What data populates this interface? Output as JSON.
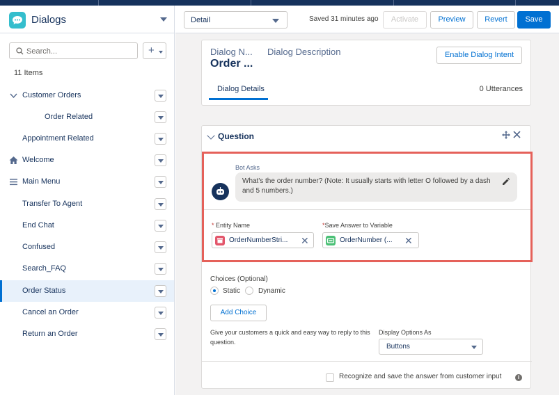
{
  "app": {
    "title": "Dialogs"
  },
  "sidebar": {
    "search_placeholder": "Search...",
    "new_button": "+",
    "items_count": "11 Items",
    "items": [
      {
        "label": "Customer Orders"
      },
      {
        "label": "Order Related"
      },
      {
        "label": "Appointment Related"
      },
      {
        "label": "Welcome"
      },
      {
        "label": "Main Menu"
      },
      {
        "label": "Transfer To Agent"
      },
      {
        "label": "End Chat"
      },
      {
        "label": "Confused"
      },
      {
        "label": "Search_FAQ"
      },
      {
        "label": "Order Status",
        "selected": true
      },
      {
        "label": "Cancel an Order"
      },
      {
        "label": "Return an Order"
      }
    ]
  },
  "toolbar": {
    "view": "Detail",
    "status": "Saved 31 minutes ago",
    "activate": "Activate",
    "preview": "Preview",
    "revert": "Revert",
    "save": "Save"
  },
  "dialog": {
    "name_label": "Dialog N...",
    "name_value": "Order ...",
    "description_label": "Dialog Description",
    "enable_intent": "Enable Dialog Intent",
    "tab": "Dialog Details",
    "utterances": "0 Utterances"
  },
  "question": {
    "title": "Question",
    "bot_asks_label": "Bot Asks",
    "bot_message": "What's the order number? (Note: It usually starts with letter O followed by a dash and 5 numbers.)",
    "entity_label": "Entity Name",
    "entity_value": "OrderNumberStri...",
    "variable_label": "Save Answer to Variable",
    "variable_value": "OrderNumber (...",
    "choices_label": "Choices (Optional)",
    "radio_static": "Static",
    "radio_dynamic": "Dynamic",
    "add_choice": "Add Choice",
    "help_text": "Give your customers a quick and easy way to reply to this question.",
    "display_label": "Display Options As",
    "display_value": "Buttons",
    "recognize_label": "Recognize and save the answer from customer input",
    "info": "i"
  },
  "colors": {
    "accent": "#0070d2",
    "header": "#16325c",
    "highlight": "#e5615a",
    "entity_icon": "#e3566b",
    "variable_icon": "#4bc076",
    "app_icon": "#34becd"
  }
}
